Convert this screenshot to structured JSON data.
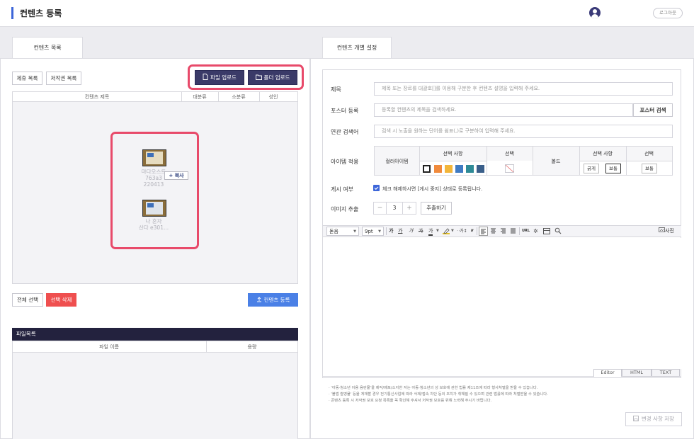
{
  "header": {
    "title": "컨텐츠 등록",
    "logout_label": "로그아웃"
  },
  "left": {
    "tab_label": "컨텐츠 목록",
    "buttons": {
      "affiliate_list": "제휴 목록",
      "copyright_list": "저작권 목록",
      "file_upload": "파일 업로드",
      "folder_upload": "폴더 업로드",
      "select_all": "전체 선택",
      "delete_selected": "선택 삭제",
      "register_content": "컨텐츠 등록"
    },
    "table_headers": [
      "컨텐츠 제목",
      "대분류",
      "소분류",
      "성인"
    ],
    "drag_items": [
      {
        "lines": [
          "마다오스트",
          "763a3",
          "220413"
        ]
      },
      {
        "lines": [
          "나 혼자",
          "산다 e301..."
        ]
      }
    ],
    "copy_tooltip": "+ 복사",
    "file_list": {
      "title": "파일목록",
      "headers": [
        "파일 이름",
        "용량"
      ]
    }
  },
  "right": {
    "tab_label": "컨텐츠 개별 설정",
    "fields": {
      "title": {
        "label": "제목",
        "placeholder": "제목 또는 장르를 대괄호[]를 이용해 구분한 후 컨텐츠 설명을 입력해 주세요."
      },
      "poster": {
        "label": "포스터 등록",
        "placeholder": "등록할 컨텐츠의 제목을 검색하세요.",
        "button": "포스터 검색"
      },
      "keyword": {
        "label": "연관 검색어",
        "placeholder": "검색 시 노출을 원하는 단어를 쉼표(,)로 구분하여 입력해 주세요."
      }
    },
    "item_apply": {
      "label": "아이템 적용",
      "color_item": "컬러아이템",
      "option_header": "선택 사항",
      "select_header": "선택",
      "bold_label": "볼드",
      "bold_options": [
        "굵게",
        "보통"
      ],
      "bold_selected": "보통",
      "swatch_colors": [
        "#ffffff",
        "#f08a3c",
        "#f2b53a",
        "#3f7ac2",
        "#2e8a96",
        "#3a5f8a"
      ]
    },
    "publish": {
      "label": "게시 여부",
      "checkbox_text": "체크 해제하시면 [게시 중지] 상태로 등록됩니다."
    },
    "image_extract": {
      "label": "이미지 추출",
      "minus": "−",
      "value": "3",
      "plus": "+",
      "button": "추출하기"
    },
    "editor": {
      "font": "돋움",
      "size": "9pt",
      "format_buttons": [
        "가",
        "가",
        "가",
        "가",
        "가"
      ],
      "photo_label": "사진",
      "tabs": [
        "Editor",
        "HTML",
        "TEXT"
      ],
      "url_label": "URL"
    },
    "notes": [
      "· '아동·청소년 이용 음란물'을 제작/배포/소지한 자는 아동·청소년의 성 보호에 관한 법률 제11조에 따라 형사처벌을 받을 수 있습니다.",
      "· '불법 촬영물' 등을 게재할 경우 전기통신사업에 따라 삭제/접속 차단 등의 조치가 취해질 수 있으며 관련 법률에 따라 처벌받을 수 있습니다.",
      "· 콘텐츠 등록 시 저작권 보호 요청 목록을 꼭 확인해 주셔서 저작권 보호를 위해 노력해 주시기 바랍니다."
    ],
    "save_button": "변경 사항 저장"
  }
}
